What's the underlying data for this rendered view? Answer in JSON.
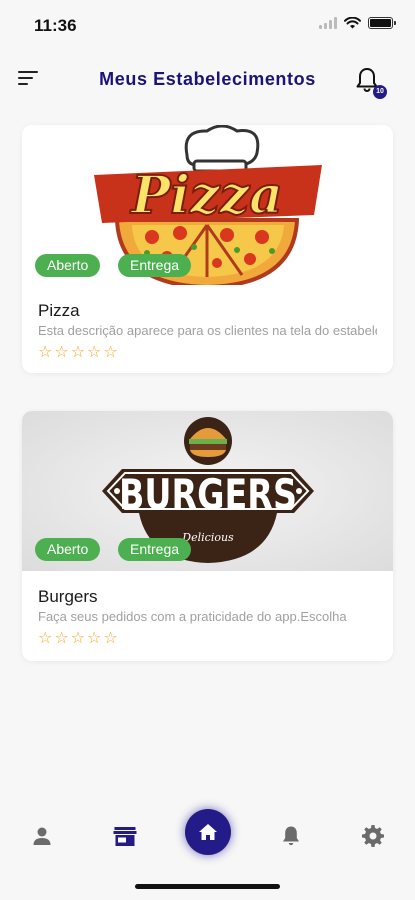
{
  "status_bar": {
    "time": "11:36"
  },
  "header": {
    "title": "Meus Estabelecimentos",
    "notification_count": "10"
  },
  "establishments": [
    {
      "name": "Pizza",
      "description": "Esta descrição aparece para os clientes na tela do estabelecimento",
      "tags": [
        "Aberto",
        "Entrega"
      ],
      "logo_text": "Pizza",
      "rating_stars": 0
    },
    {
      "name": "Burgers",
      "description": "Faça seus pedidos com a praticidade do app.Escolha",
      "tags": [
        "Aberto",
        "Entrega"
      ],
      "logo_text": "BURGERS",
      "logo_subtext": "Delicious",
      "rating_stars": 0
    }
  ],
  "bottom_nav": [
    "person-icon",
    "store-icon",
    "home-icon",
    "bell-icon",
    "gear-icon"
  ],
  "colors": {
    "primary": "#231b87",
    "tag_green": "#4caf50",
    "star": "#f5a623"
  }
}
